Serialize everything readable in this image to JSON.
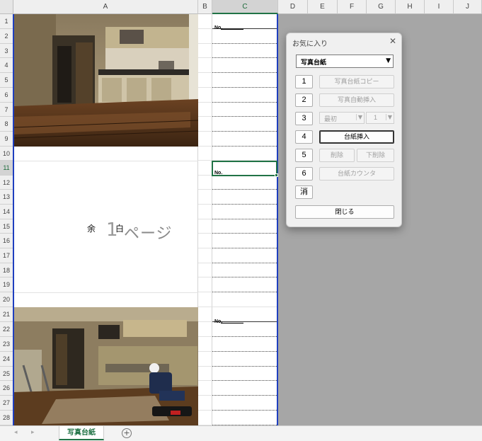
{
  "columns": [
    "A",
    "B",
    "C",
    "D",
    "E",
    "F",
    "G",
    "H",
    "I",
    "J"
  ],
  "rows": [
    "1",
    "2",
    "3",
    "4",
    "5",
    "6",
    "7",
    "8",
    "9",
    "10",
    "11",
    "12",
    "13",
    "14",
    "15",
    "16",
    "17",
    "18",
    "19",
    "20",
    "21",
    "22",
    "23",
    "24",
    "25",
    "26",
    "27",
    "28"
  ],
  "blocks": [
    {
      "no_label": "No."
    },
    {
      "no_label": "No."
    },
    {
      "no_label": "No."
    }
  ],
  "blank_page": {
    "char1": "余",
    "char2": "白",
    "number": "1",
    "suffix": "ページ"
  },
  "dialog": {
    "title": "お気に入り",
    "close": "✕",
    "dropdown_value": "写真台紙",
    "buttons": {
      "n1": "1",
      "b1": "写真台紙コピー",
      "n2": "2",
      "b2": "写真自動挿入",
      "n3": "3",
      "sel3a": "最初",
      "sel3b": "1",
      "n4": "4",
      "b4": "台紙挿入",
      "n5": "5",
      "b5a": "削除",
      "b5b": "下削除",
      "n6": "6",
      "b6": "台紙カウンタ",
      "clear": "消",
      "close_btn": "閉じる"
    }
  },
  "tabs": {
    "active": "写真台紙",
    "add": "+",
    "prev": "◂",
    "next": "▸"
  }
}
